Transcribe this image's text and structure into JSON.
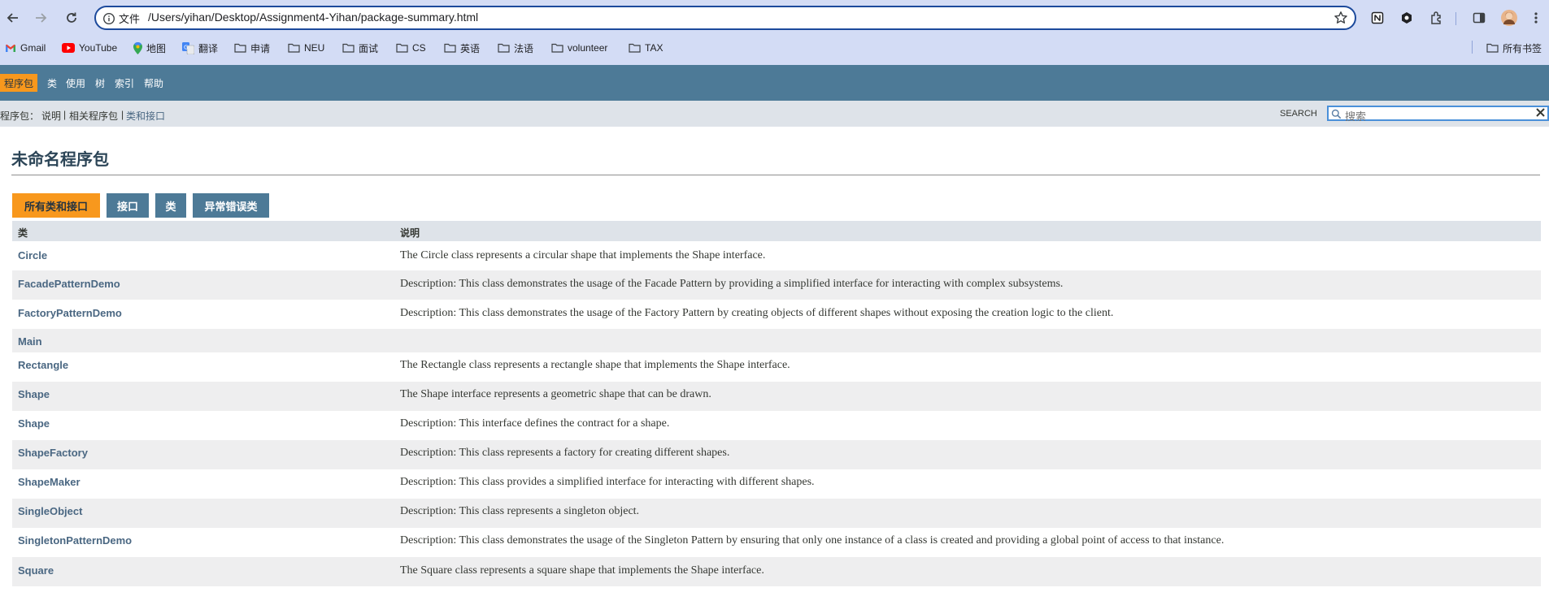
{
  "browser": {
    "scheme_label": "文件",
    "url": "/Users/yihan/Desktop/Assignment4-Yihan/package-summary.html",
    "bookmarks": [
      {
        "label": "Gmail",
        "icon": "gmail-icon"
      },
      {
        "label": "YouTube",
        "icon": "youtube-icon"
      },
      {
        "label": "地图",
        "icon": "maps-pin-icon"
      },
      {
        "label": "翻译",
        "icon": "translate-icon"
      },
      {
        "label": "申请",
        "icon": "folder-icon"
      },
      {
        "label": "NEU",
        "icon": "folder-icon"
      },
      {
        "label": "面试",
        "icon": "folder-icon"
      },
      {
        "label": "CS",
        "icon": "folder-icon"
      },
      {
        "label": "英语",
        "icon": "folder-icon"
      },
      {
        "label": "法语",
        "icon": "folder-icon"
      },
      {
        "label": "volunteer",
        "icon": "folder-icon"
      },
      {
        "label": "TAX",
        "icon": "folder-icon"
      }
    ],
    "all_bookmarks_label": "所有书签"
  },
  "nav": {
    "items": [
      "程序包",
      "类",
      "使用",
      "树",
      "索引",
      "帮助"
    ]
  },
  "subnav": {
    "prefix": "程序包：",
    "links": [
      "说明",
      "相关程序包",
      "类和接口"
    ],
    "separator": "|",
    "search_label": "SEARCH",
    "search_placeholder": "搜索"
  },
  "page": {
    "title": "未命名程序包",
    "tabs": [
      "所有类和接口",
      "接口",
      "类",
      "异常错误类"
    ],
    "columns": [
      "类",
      "说明"
    ],
    "rows": [
      {
        "name": "Circle",
        "desc": "The Circle class represents a circular shape that implements the Shape interface."
      },
      {
        "name": "FacadePatternDemo",
        "desc": "Description: This class demonstrates the usage of the Facade Pattern by providing a simplified interface for interacting with complex subsystems."
      },
      {
        "name": "FactoryPatternDemo",
        "desc": "Description: This class demonstrates the usage of the Factory Pattern by creating objects of different shapes without exposing the creation logic to the client."
      },
      {
        "name": "Main",
        "desc": ""
      },
      {
        "name": "Rectangle",
        "desc": "The Rectangle class represents a rectangle shape that implements the Shape interface."
      },
      {
        "name": "Shape",
        "desc": "The Shape interface represents a geometric shape that can be drawn."
      },
      {
        "name": "Shape",
        "desc": "Description: This interface defines the contract for a shape."
      },
      {
        "name": "ShapeFactory",
        "desc": "Description: This class represents a factory for creating different shapes."
      },
      {
        "name": "ShapeMaker",
        "desc": "Description: This class provides a simplified interface for interacting with different shapes."
      },
      {
        "name": "SingleObject",
        "desc": "Description: This class represents a singleton object."
      },
      {
        "name": "SingletonPatternDemo",
        "desc": "Description: This class demonstrates the usage of the Singleton Pattern by ensuring that only one instance of a class is created and providing a global point of access to that instance."
      },
      {
        "name": "Square",
        "desc": "The Square class represents a square shape that implements the Shape interface."
      }
    ]
  },
  "colors": {
    "nav_bg": "#4d7a97",
    "accent_orange": "#f8981d",
    "subnav_bg": "#dee3e9",
    "link": "#4a6782",
    "chrome_bg": "#d3dcf5"
  }
}
